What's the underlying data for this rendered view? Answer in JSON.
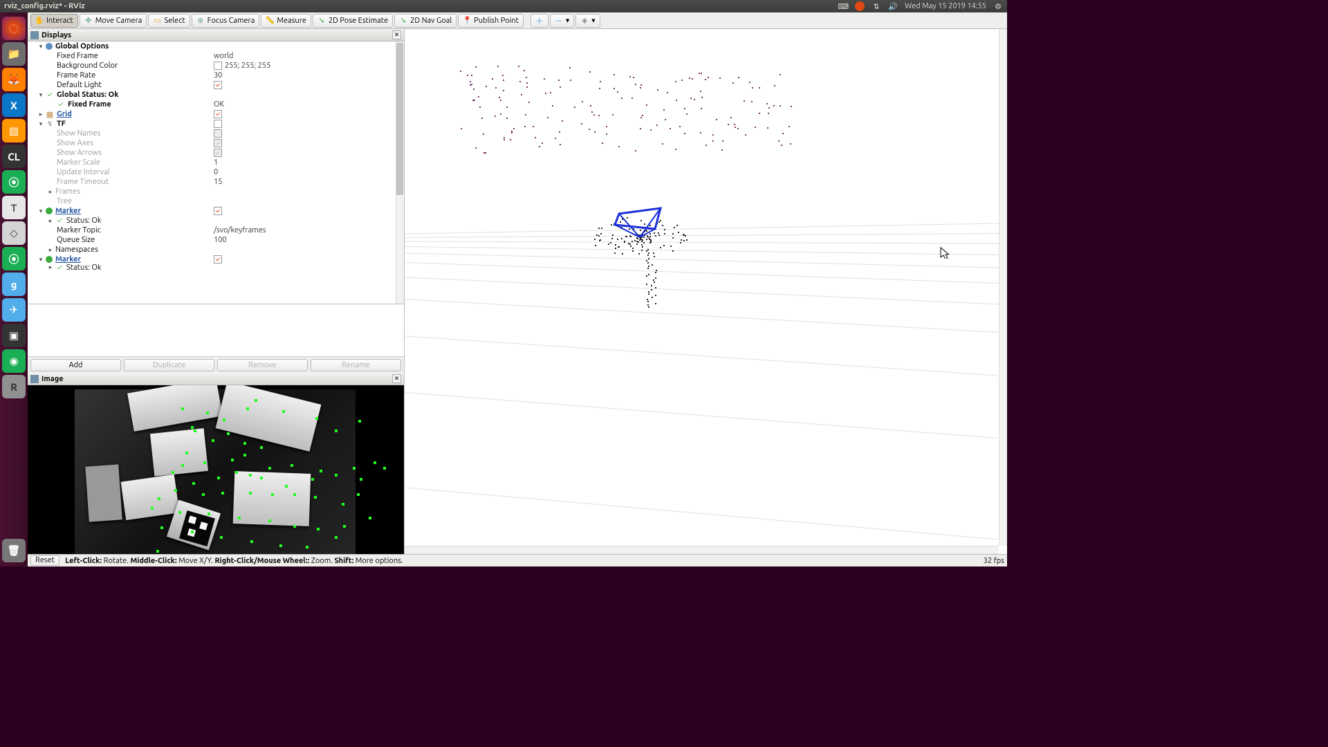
{
  "menubar": {
    "title": "rviz_config.rviz* - RViz",
    "datetime": "Wed May 15 2019 14:55"
  },
  "toolbar": {
    "interact": "Interact",
    "move_camera": "Move Camera",
    "select": "Select",
    "focus_camera": "Focus Camera",
    "measure": "Measure",
    "pose_2d": "2D Pose Estimate",
    "nav_2d": "2D Nav Goal",
    "publish_point": "Publish Point"
  },
  "displays": {
    "title": "Displays",
    "global_options": {
      "label": "Global Options",
      "fixed_frame_label": "Fixed Frame",
      "fixed_frame_value": "world",
      "bg_color_label": "Background Color",
      "bg_color_value": "255; 255; 255",
      "frame_rate_label": "Frame Rate",
      "frame_rate_value": "30",
      "default_light_label": "Default Light"
    },
    "global_status": {
      "label": "Global Status: Ok",
      "fixed_frame_label": "Fixed Frame",
      "fixed_frame_value": "OK"
    },
    "grid": {
      "label": "Grid"
    },
    "tf": {
      "label": "TF",
      "show_names": "Show Names",
      "show_axes": "Show Axes",
      "show_arrows": "Show Arrows",
      "marker_scale_label": "Marker Scale",
      "marker_scale_value": "1",
      "update_interval_label": "Update Interval",
      "update_interval_value": "0",
      "frame_timeout_label": "Frame Timeout",
      "frame_timeout_value": "15",
      "frames": "Frames",
      "tree": "Tree"
    },
    "marker1": {
      "label": "Marker",
      "status": "Status: Ok",
      "topic_label": "Marker Topic",
      "topic_value": "/svo/keyframes",
      "queue_label": "Queue Size",
      "queue_value": "100",
      "namespaces": "Namespaces"
    },
    "marker2": {
      "label": "Marker",
      "status": "Status: Ok"
    },
    "buttons": {
      "add": "Add",
      "duplicate": "Duplicate",
      "remove": "Remove",
      "rename": "Rename"
    }
  },
  "image_panel": {
    "title": "Image"
  },
  "statusbar": {
    "reset": "Reset",
    "left_click_l": "Left-Click:",
    "left_click_v": " Rotate. ",
    "middle_click_l": "Middle-Click:",
    "middle_click_v": " Move X/Y. ",
    "right_click_l": "Right-Click/Mouse Wheel::",
    "right_click_v": " Zoom. ",
    "shift_l": "Shift:",
    "shift_v": " More options.",
    "fps": "32 fps"
  }
}
